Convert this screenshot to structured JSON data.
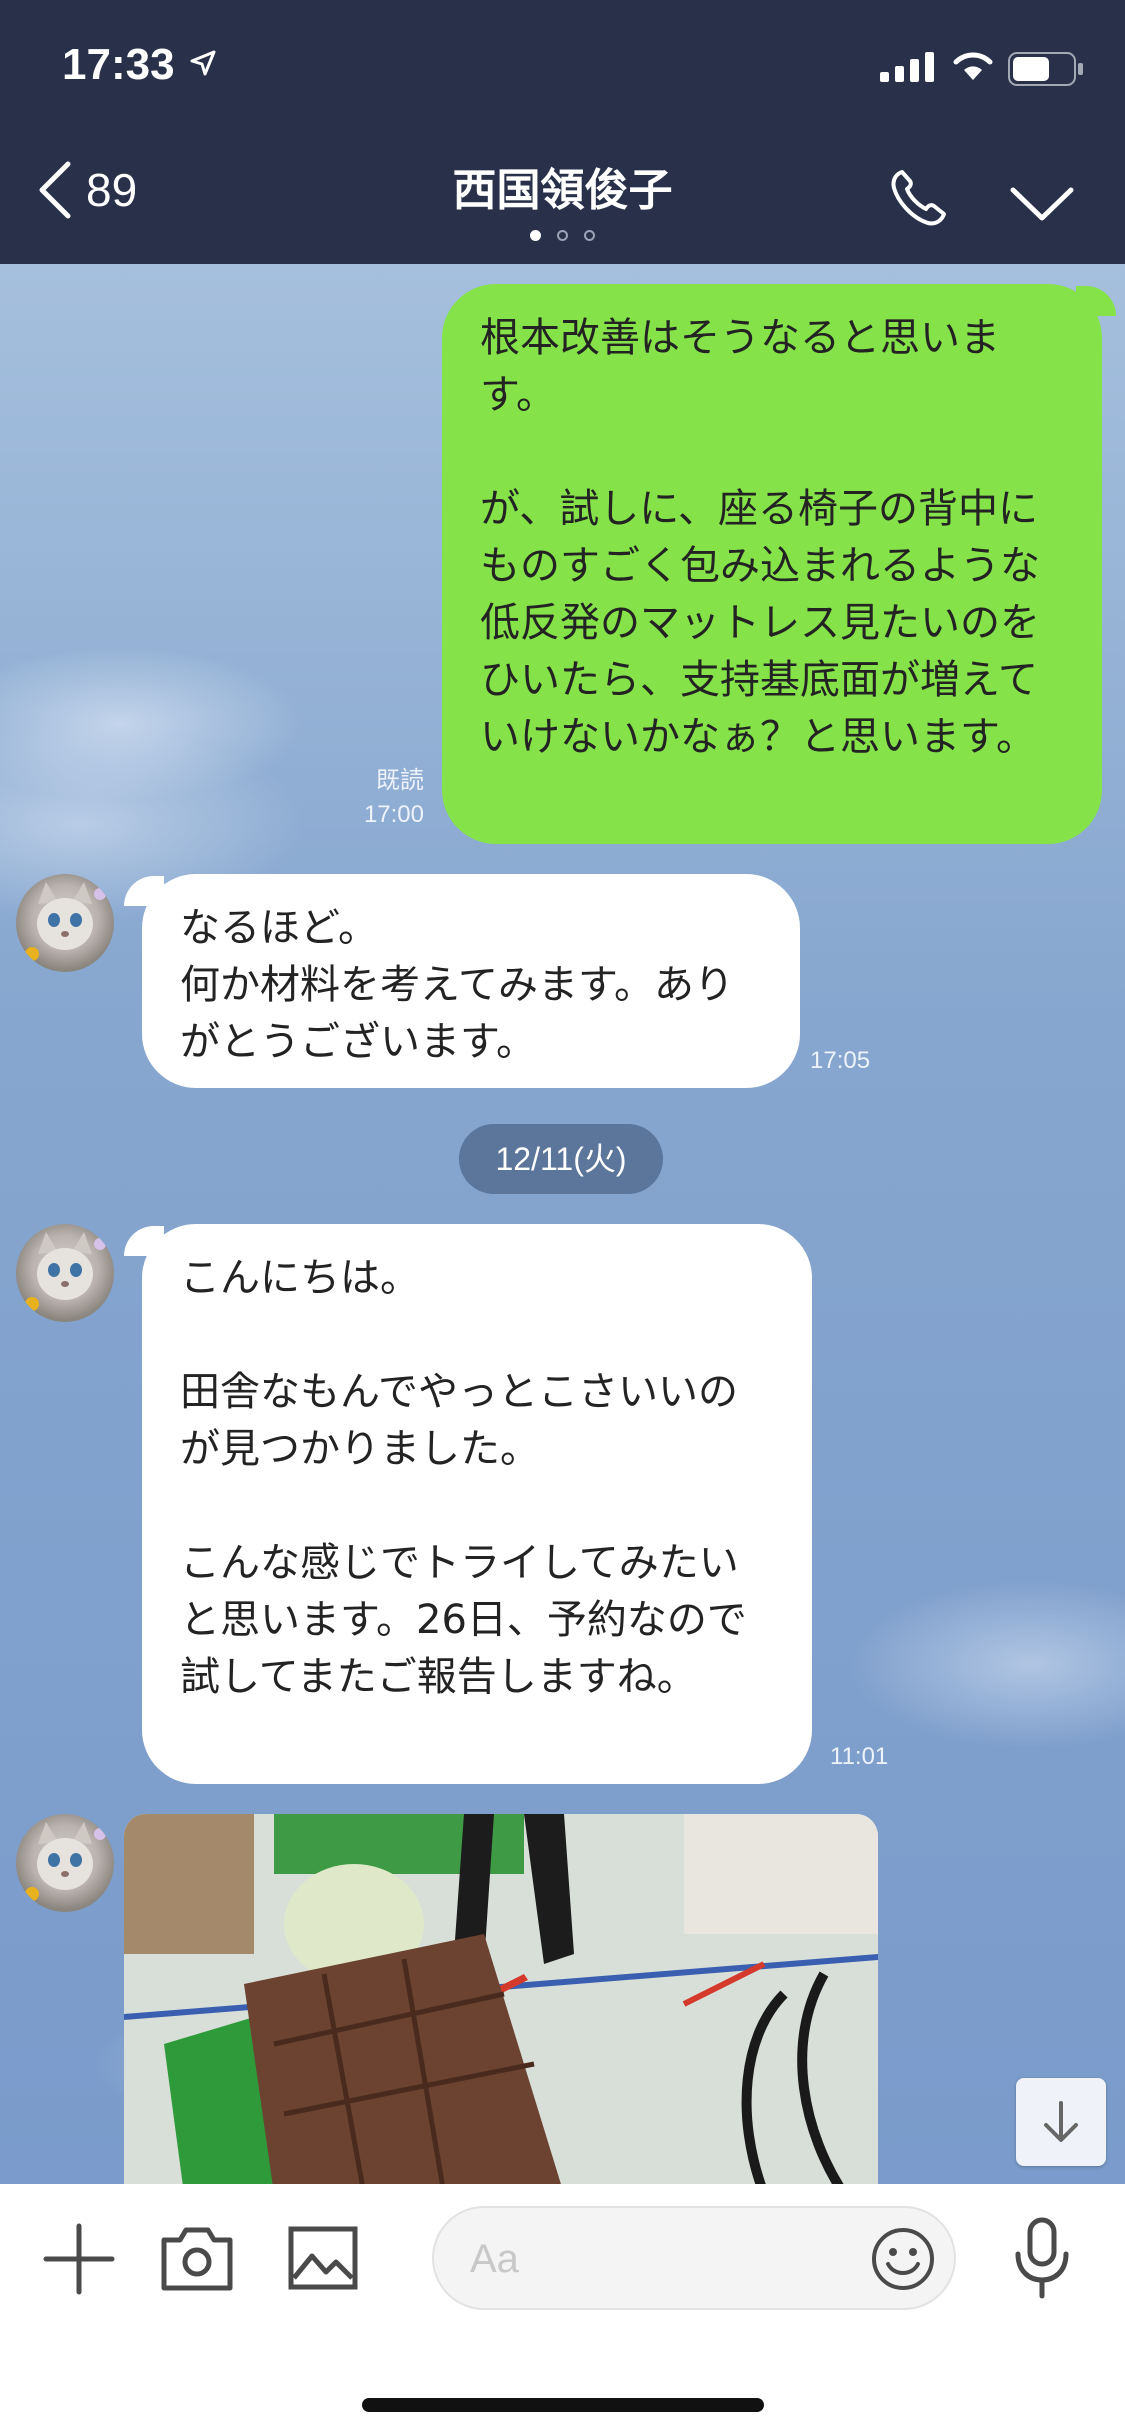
{
  "status_bar": {
    "time": "17:33"
  },
  "header": {
    "back_count": "89",
    "title": "西国領俊子"
  },
  "messages": [
    {
      "direction": "out",
      "text": "根本改善はそうなると思います。\n\nが、試しに、座る椅子の背中にものすごく包み込まれるような低反発のマットレス見たいのをひいたら、支持基底面が増えていけないかなぁ？と思います。",
      "read_label": "既読",
      "time": "17:00"
    },
    {
      "direction": "in",
      "text": "なるほど。\n何か材料を考えてみます。ありがとうございます。",
      "time": "17:05"
    },
    {
      "date_separator": "12/11(火)"
    },
    {
      "direction": "in",
      "text": "こんにちは。\n\n田舎なもんでやっとこさいいのが見つかりました。\n\nこんな感じでトライしてみたいと思います。26日、予約なので試してまたご報告しますね。",
      "time": "11:01"
    },
    {
      "direction": "in",
      "type": "photo"
    }
  ],
  "input": {
    "placeholder": "Aa"
  },
  "colors": {
    "header_bg": "#283149",
    "out_bubble": "#85e249",
    "in_bubble": "#ffffff"
  },
  "icons": [
    "location-arrow-icon",
    "signal-icon",
    "wifi-icon",
    "battery-icon",
    "chevron-left-icon",
    "phone-icon",
    "chevron-down-icon",
    "plus-icon",
    "camera-icon",
    "image-icon",
    "emoji-icon",
    "microphone-icon",
    "arrow-down-icon"
  ]
}
